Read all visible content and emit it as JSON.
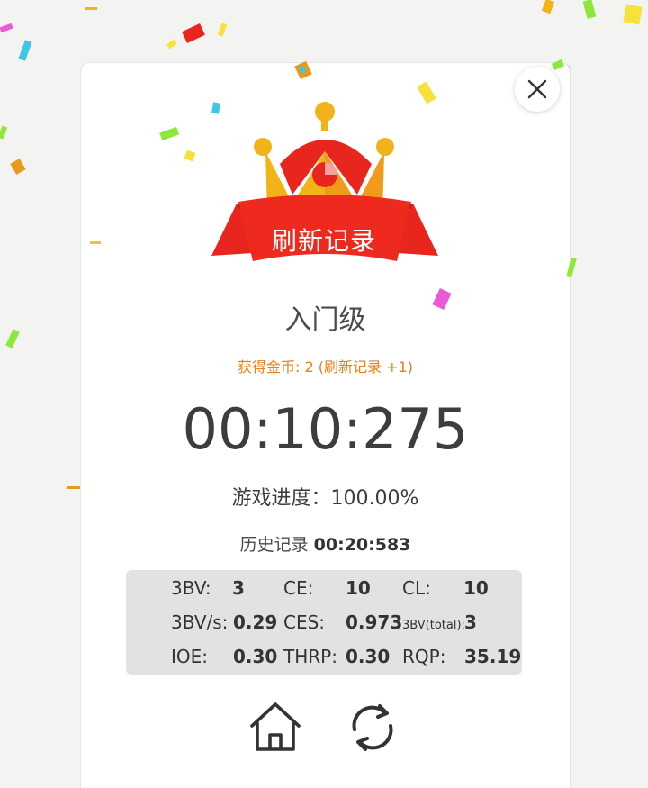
{
  "dialog": {
    "badge_text": "刷新记录",
    "level": "入门级",
    "coins_text": "获得金币: 2 (刷新记录 +1)",
    "time": "00:10:275",
    "progress_text": "游戏进度：100.00%",
    "history_label": "历史记录",
    "history_value": "00:20:583"
  },
  "stats": {
    "bv_label": "3BV:",
    "bv_value": "3",
    "ce_label": "CE:",
    "ce_value": "10",
    "cl_label": "CL:",
    "cl_value": "10",
    "bvs_label": "3BV/s:",
    "bvs_value": "0.29",
    "ces_label": "CES:",
    "ces_value": "0.973",
    "bvtotal_label": "3BV(total):",
    "bvtotal_value": "3",
    "ioe_label": "IOE:",
    "ioe_value": "0.30",
    "thrp_label": "THRP:",
    "thrp_value": "0.30",
    "rqp_label": "RQP:",
    "rqp_value": "35.19"
  },
  "icons": {
    "close": "close-icon",
    "home": "home-icon",
    "restart": "refresh-icon",
    "crown": "crown-icon"
  },
  "colors": {
    "coins_text": "#e8801a",
    "ribbon": "#e8261e",
    "crown_gold": "#f2b21a",
    "stats_bg": "#e2e2e2"
  }
}
